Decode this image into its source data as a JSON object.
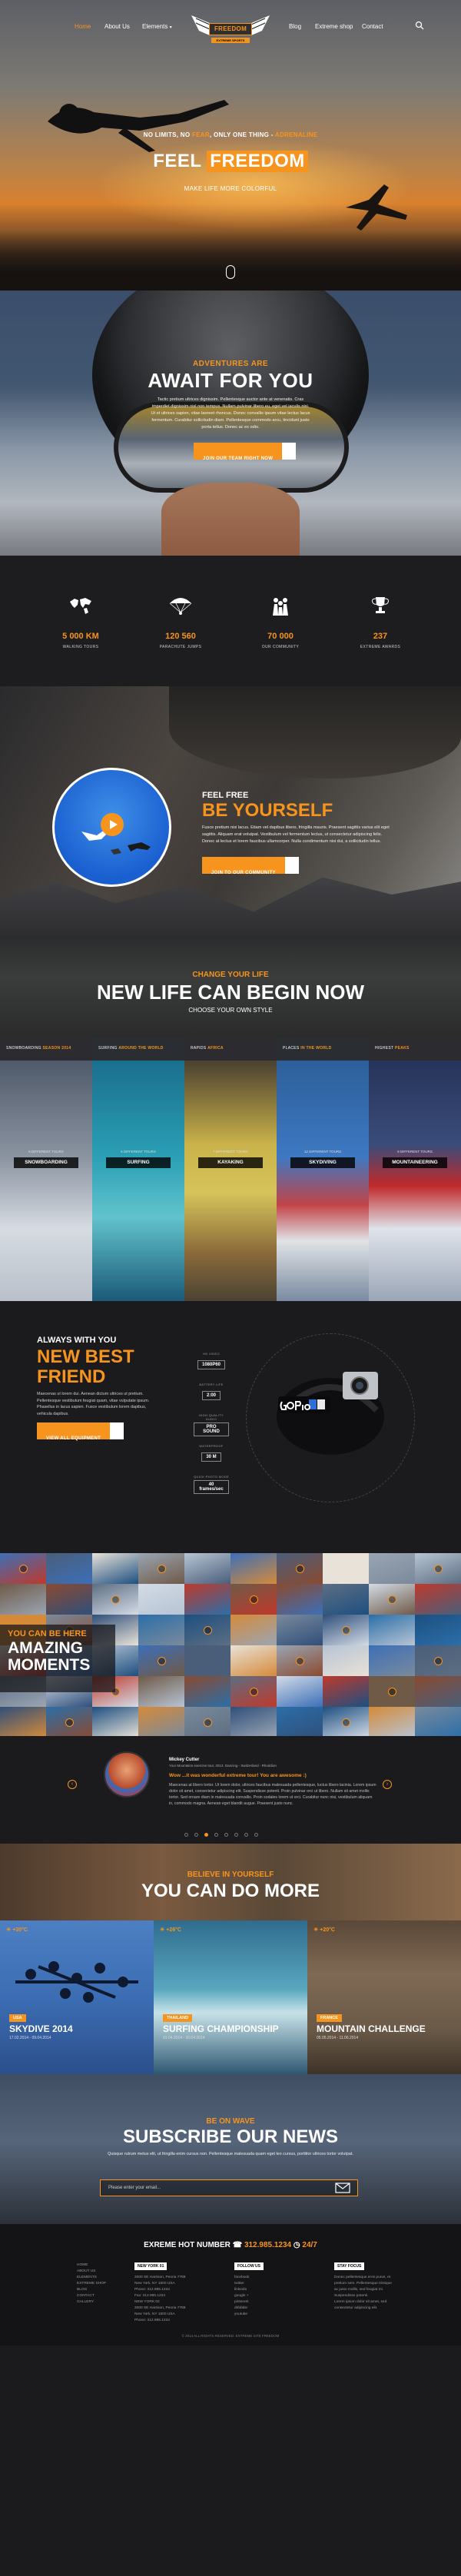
{
  "nav": {
    "left": [
      "Home",
      "About Us",
      "Elements"
    ],
    "right": [
      "Blog",
      "Extreme shop",
      "Contact"
    ],
    "logo_text": "FREEDOM",
    "logo_sub": "EXTREME SPORTS"
  },
  "hero": {
    "tagline_pre": "NO LIMITS, NO ",
    "tagline_fear": "FEAR",
    "tagline_mid": ", ONLY ONE THING - ",
    "tagline_end": "ADRENALINE",
    "headline_a": "FEEL",
    "headline_b": "FREEDOM",
    "subline": "MAKE LIFE MORE COLORFUL"
  },
  "adventure": {
    "kicker": "ADVENTURES ARE",
    "title": "AWAIT FOR YOU",
    "text": "Tactic pretium ultrices dignissim. Pellentesque auctor ante at venenatis. Cras imperdiet dignissim nisl non tempus. Nullam pulvinar libero eu, eget vel iaculis nisi. Ut et ultrices sapien, vitae laoreet rhoncus. Donec convallis ipsum vitae lectus lacus fermentum. Curabitur sollicitudin diam. Pellentesque commodo arcu, tincidunt justo porta tellus. Donec ac ex odio.",
    "button": "JOIN OUR TEAM RIGHT NOW"
  },
  "stats": [
    {
      "value": "5 000 KM",
      "label": "WALKING TOURS"
    },
    {
      "value": "120 560",
      "label": "PARACHUTE JUMPS"
    },
    {
      "value": "70 000",
      "label": "OUR COMMUNITY"
    },
    {
      "value": "237",
      "label": "EXTREME AWARDS"
    }
  ],
  "free": {
    "kicker": "FEEL FREE",
    "title": "BE YOURSELF",
    "text": "Fusce pretium nisi lacus. Etiam vel dapibus libero, fringilla mauris. Praesent sagittis varius elit eget sagittis. Aliquam erat volutpat. Vestibulum vel fermentum lectus, ut consectetur adipiscing felis. Donec at lectus et lorem faucibus ullamcorper. Nulla condimentum nisi dui, a sollicitudin tellus.",
    "button": "JOIN TO OUR COMMUNITY"
  },
  "change": {
    "kicker": "CHANGE YOUR LIFE",
    "title": "NEW LIFE CAN BEGIN NOW",
    "sub": "CHOOSE YOUR OWN STYLE"
  },
  "sports": [
    {
      "top_pre": "SNOWBOARDING",
      "top_sp": "SEASON 2014",
      "caption": "8 DIFFERENT TOURS",
      "tag": "SNOWBOARDING"
    },
    {
      "top_pre": "SURFING",
      "top_sp": "AROUND THE WORLD",
      "caption": "5 DIFFERENT TOURS",
      "tag": "SURFING"
    },
    {
      "top_pre": "RAPIDS",
      "top_sp": "AFRICA",
      "caption": "7 DIFFERENT TOURS",
      "tag": "KAYAKING"
    },
    {
      "top_pre": "PLACES",
      "top_sp": "IN THE WORLD",
      "caption": "12 DIFFERENT TOURS",
      "tag": "SKYDIVING"
    },
    {
      "top_pre": "HIGHEST",
      "top_sp": "PEAKS",
      "caption": "9 DIFFERENT TOURS",
      "tag": "MOUNTAINEERING"
    }
  ],
  "gear": {
    "kicker": "ALWAYS WITH YOU",
    "title": "NEW BEST FRIEND",
    "text": "Maecenas ut lorem dui. Aenean dictum ultrices ut pretium. Pellentesque vestibulum feugiat quam, vitae vulputate ipsum. Phasellus in lacus sapien. Fusce vestibulum lorem dapibus, vehicula dapibus.",
    "button": "VIEW ALL EQUIPMENT",
    "specs": [
      {
        "label": "HD VIDEO",
        "value": "1080P60"
      },
      {
        "label": "BATTERY LIFE",
        "value": "2:00"
      },
      {
        "label": "HIGH QUALITY AUDIO",
        "value": "PRO SOUND"
      },
      {
        "label": "WATERPROOF",
        "value": "30 M"
      },
      {
        "label": "QUICK PHOTO MODE",
        "value": "40 frames/sec"
      }
    ]
  },
  "moments": {
    "kicker": "YOU CAN BE HERE",
    "title": "AMAZING MOMENTS"
  },
  "testimonial": {
    "name": "Mickey Cutter",
    "role": "Your Mountains exercise tour, 2013. Dancing - Switzerland - Rhoddion",
    "quote": "Wow ...it was wonderful extreme tour! You are awesome :)",
    "text": "Maecenas at libero tortor. Ut lorem dolor, ultrices faucibus malesuada pellentesque, luctus libero lacinia. Lorem ipsum dolor sit amet, consectetur adipiscing elit. Suspendisse potenti. Proin pulvinar orci ut libero. Nullam sit amet mollis tortor. Sed ornare diam in malesuada convallis. Proin sodales lorem ut orci. Curabitur nunc nisi, vestibulum aliquam in, commodo magna. Aenean eget blandit augue. Praesent justo nunc."
  },
  "domore": {
    "kicker": "BELIEVE IN YOURSELF",
    "title": "YOU CAN DO MORE"
  },
  "events": [
    {
      "temp": "+30°C",
      "country": "USA",
      "title": "SKYDIVE 2014",
      "date": "17.02.2014 - 09.04.2014"
    },
    {
      "temp": "+26°C",
      "country": "THAILAND",
      "title": "SURFING CHAMPIONSHIP",
      "date": "01.04.2014 - 30.04.2014"
    },
    {
      "temp": "+20°C",
      "country": "FRANCE",
      "title": "MOUNTAIN CHALLENGE",
      "date": "05.05.2014 - 11.06.2014"
    }
  ],
  "news": {
    "kicker": "BE ON WAVE",
    "title": "SUBSCRIBE OUR NEWS",
    "text": "Quisque rutrum metus elit, ut fringilla enim cursus non. Pellentesque malesuada quam eget leo cursus, porttitor ultrices tortor volutpat.",
    "placeholder": "Please enter your email..."
  },
  "footer": {
    "hot_label": "EXREME HOT NUMBER",
    "hot_number": "312.985.1234",
    "hot_hours": "24/7",
    "cols": [
      {
        "head": "",
        "lines": [
          "HOME",
          "ABOUT US",
          "ELEMENTS",
          "EXTREME SHOP",
          "BLOG",
          "CONTACT",
          "GALLERY"
        ]
      },
      {
        "head": "NEW YORK 01",
        "lines": [
          "2000 SE Harrison, Peoria 7788",
          "New York, NY 1500 USA",
          "Phone: 312.985.1234",
          "Fax: 312.985.1234",
          "NEW YORK 02",
          "2000 SE Harrison, Peoria 7788",
          "New York, NY 1500 USA",
          "Phone: 312.985.1234"
        ]
      },
      {
        "head": "FOLLOW US",
        "lines": [
          "facebook",
          "twitter",
          "linkedin",
          "google +",
          "pinterest",
          "dribbble",
          "youtube"
        ]
      },
      {
        "head": "STAY FOCUS",
        "lines": [
          "Donec pellentesque eros purus, et",
          "pretium sem. Pellentesque tristique",
          "ac justo mollis, sed feugiat mi.",
          "Suspendisse potenti.",
          "Lorem ipsum dolor sit amet, sed",
          "consectetur adipiscing elit."
        ]
      }
    ],
    "copyright": "© 2014 ALL RIGHTS RESERVED. EXTREME SITE FREEDOM"
  }
}
